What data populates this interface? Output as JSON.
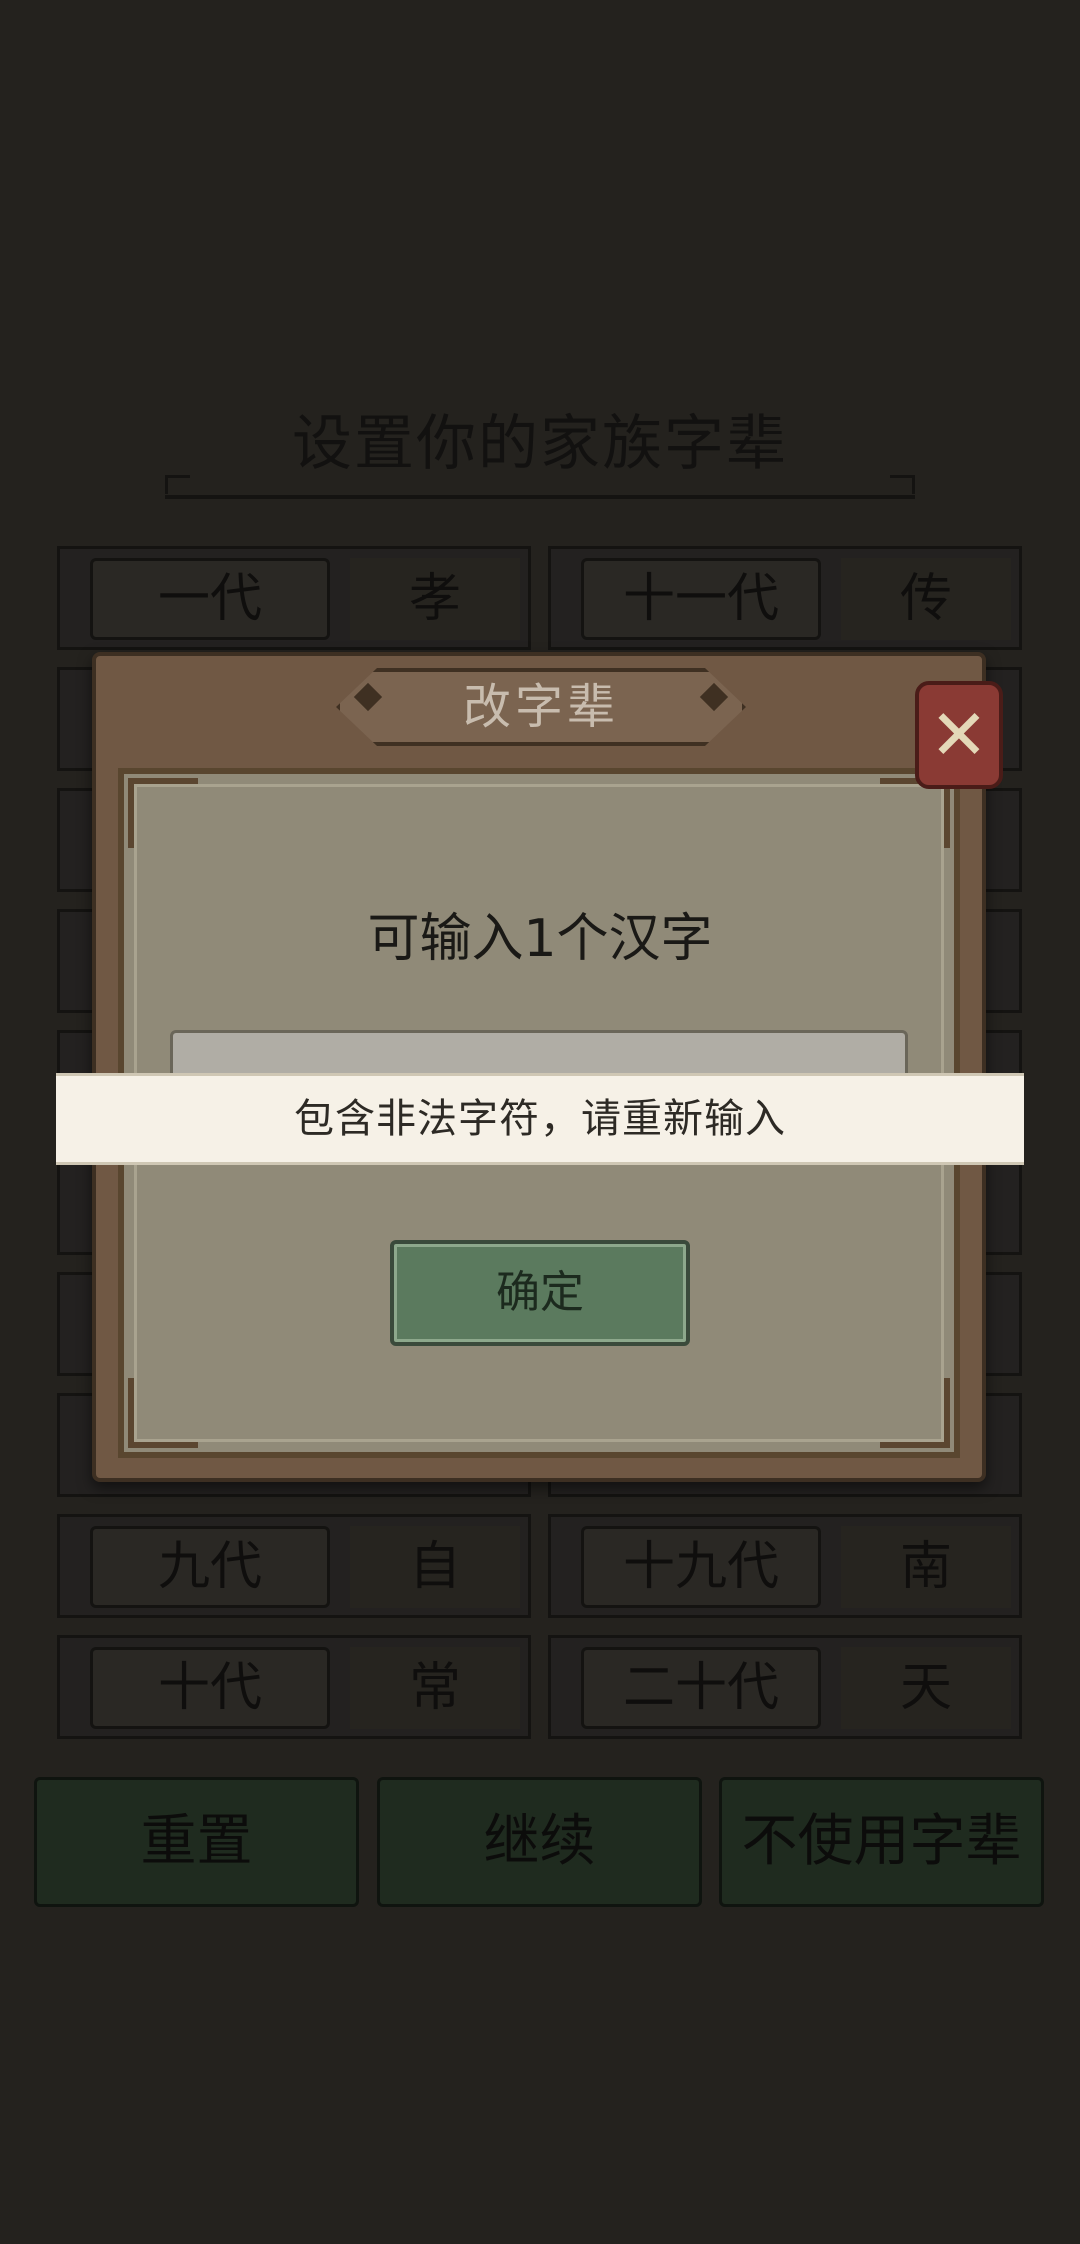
{
  "background": {
    "title": "设置你的家族字辈",
    "generations_left": [
      {
        "label": "一代",
        "char": "孝"
      },
      {
        "label": "九代",
        "char": "自"
      },
      {
        "label": "十代",
        "char": "常"
      }
    ],
    "generations_right": [
      {
        "label": "十一代",
        "char": "传"
      },
      {
        "label": "十九代",
        "char": "南"
      },
      {
        "label": "二十代",
        "char": "天"
      }
    ],
    "buttons": {
      "reset": "重置",
      "continue": "继续",
      "no_generation_names": "不使用字辈"
    }
  },
  "dialog": {
    "title": "改字辈",
    "prompt": "可输入1个汉字",
    "input_value": "",
    "confirm_label": "确定",
    "close_icon": "close-icon"
  },
  "toast": {
    "message": "包含非法字符，请重新输入"
  },
  "colors": {
    "background": "#24221e",
    "dialog_frame": "#705844",
    "dialog_panel": "#908a78",
    "confirm_button": "#5b7a5e",
    "close_button": "#8a3a34",
    "toast": "#f6f1e7"
  }
}
